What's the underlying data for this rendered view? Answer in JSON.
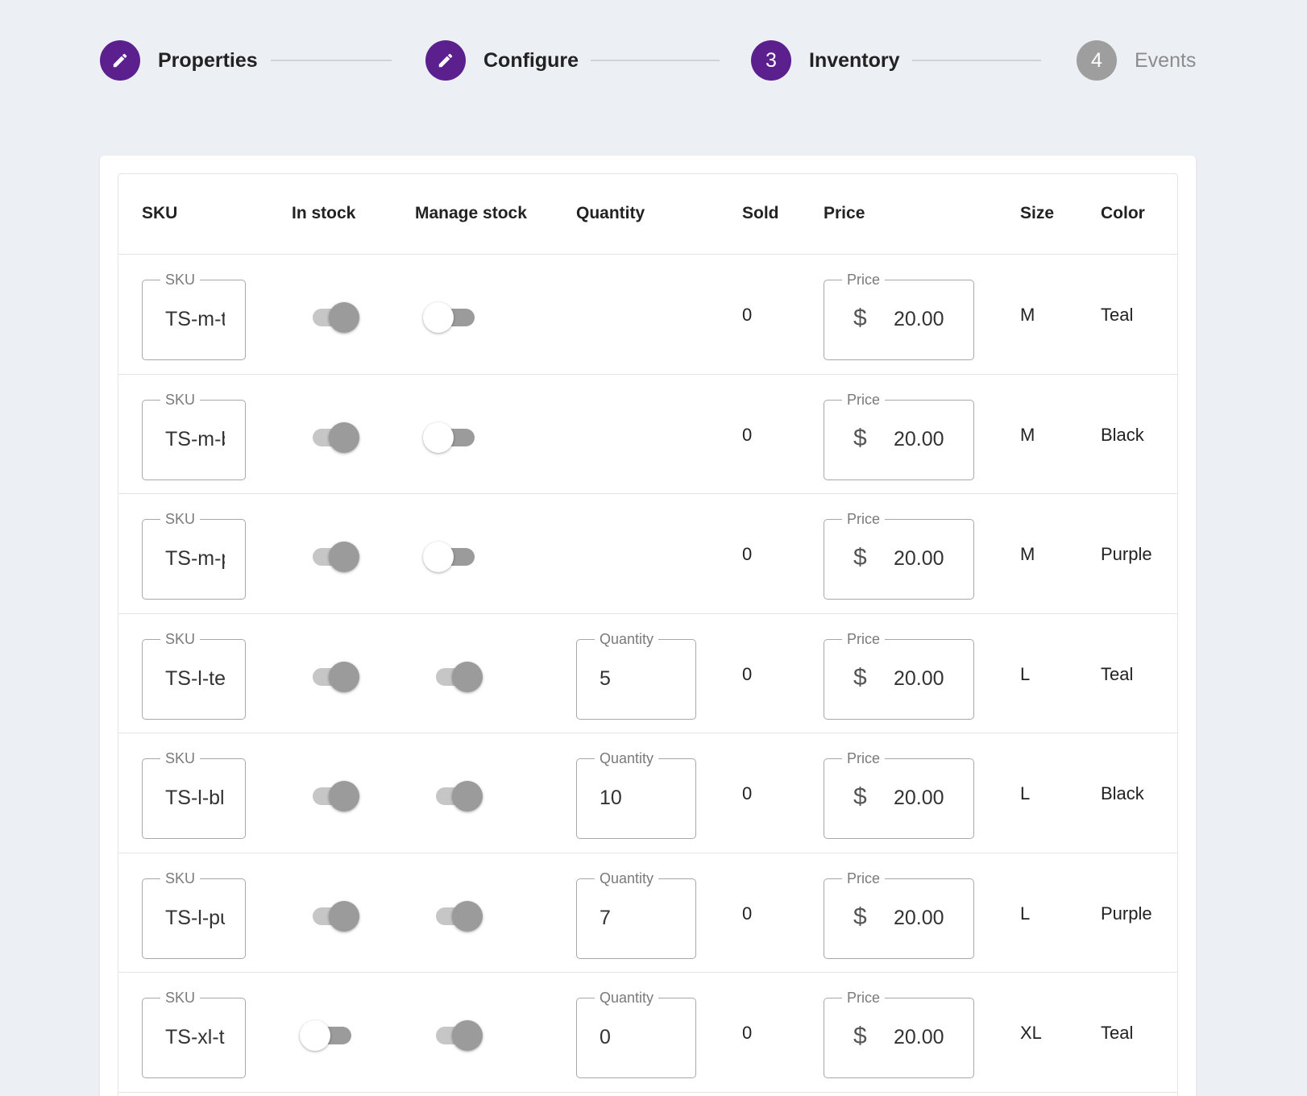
{
  "stepper": {
    "steps": [
      {
        "label": "Properties",
        "marker": "",
        "icon": "pencil-icon",
        "state": "done"
      },
      {
        "label": "Configure",
        "marker": "",
        "icon": "pencil-icon",
        "state": "done"
      },
      {
        "label": "Inventory",
        "marker": "3",
        "state": "active"
      },
      {
        "label": "Events",
        "marker": "4",
        "state": "inactive"
      }
    ]
  },
  "colors": {
    "accent": "#5b1f8e",
    "inactive_step": "#9e9e9e",
    "background": "#eceff3"
  },
  "table": {
    "headers": {
      "sku": "SKU",
      "in_stock": "In stock",
      "manage_stock": "Manage stock",
      "quantity": "Quantity",
      "sold": "Sold",
      "price": "Price",
      "size": "Size",
      "color": "Color"
    },
    "field_labels": {
      "sku": "SKU",
      "quantity": "Quantity",
      "price": "Price",
      "currency": "$"
    },
    "rows": [
      {
        "sku": "TS-m-teal",
        "in_stock": true,
        "manage_stock": false,
        "quantity": null,
        "sold": "0",
        "price": "20.00",
        "size": "M",
        "color": "Teal"
      },
      {
        "sku": "TS-m-black",
        "in_stock": true,
        "manage_stock": false,
        "quantity": null,
        "sold": "0",
        "price": "20.00",
        "size": "M",
        "color": "Black"
      },
      {
        "sku": "TS-m-purple",
        "in_stock": true,
        "manage_stock": false,
        "quantity": null,
        "sold": "0",
        "price": "20.00",
        "size": "M",
        "color": "Purple"
      },
      {
        "sku": "TS-l-teal",
        "in_stock": true,
        "manage_stock": true,
        "quantity": "5",
        "sold": "0",
        "price": "20.00",
        "size": "L",
        "color": "Teal"
      },
      {
        "sku": "TS-l-black",
        "in_stock": true,
        "manage_stock": true,
        "quantity": "10",
        "sold": "0",
        "price": "20.00",
        "size": "L",
        "color": "Black"
      },
      {
        "sku": "TS-l-purple",
        "in_stock": true,
        "manage_stock": true,
        "quantity": "7",
        "sold": "0",
        "price": "20.00",
        "size": "L",
        "color": "Purple"
      },
      {
        "sku": "TS-xl-teal",
        "in_stock": false,
        "manage_stock": true,
        "quantity": "0",
        "sold": "0",
        "price": "20.00",
        "size": "XL",
        "color": "Teal"
      }
    ]
  }
}
